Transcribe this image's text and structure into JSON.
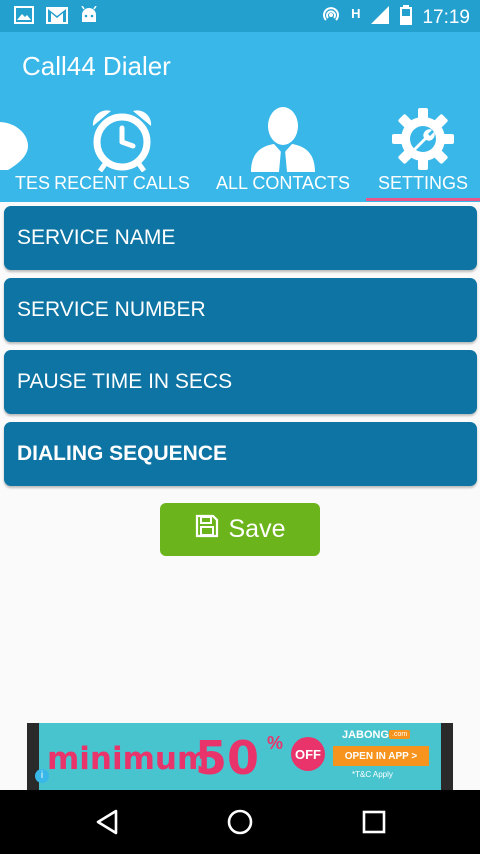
{
  "status_bar": {
    "time": "17:19",
    "network_label": "H",
    "icons": [
      "image-icon",
      "gmail-icon",
      "android-icon",
      "hotspot-icon",
      "signal-icon",
      "battery-icon"
    ]
  },
  "app": {
    "title": "Call44 Dialer",
    "colors": {
      "primary": "#39b7e8",
      "status": "#24a0cf",
      "card": "#0e74a3",
      "save": "#6cb41b",
      "indicator": "#e8578a"
    }
  },
  "tabs": [
    {
      "label": "TES",
      "icon": "favorite-icon"
    },
    {
      "label": "RECENT CALLS",
      "icon": "alarm-clock-icon"
    },
    {
      "label": "ALL CONTACTS",
      "icon": "person-icon"
    },
    {
      "label": "SETTINGS",
      "icon": "settings-wrench-icon",
      "selected": true
    }
  ],
  "settings": [
    {
      "label": "SERVICE NAME",
      "bold": false
    },
    {
      "label": "SERVICE NUMBER",
      "bold": false
    },
    {
      "label": "PAUSE TIME IN SECS",
      "bold": false
    },
    {
      "label": "DIALING SEQUENCE",
      "bold": true
    }
  ],
  "save_button": {
    "label": "Save",
    "icon": "floppy-disk-icon"
  },
  "ad": {
    "headline": "minimum",
    "percent_value": "50",
    "percent_sign": "%",
    "off_label": "OFF",
    "brand": "JABONG",
    "brand_suffix": ".com",
    "cta": "OPEN IN APP >",
    "terms": "*T&C Apply"
  },
  "nav_bar": {
    "buttons": [
      "back-icon",
      "home-icon",
      "recents-icon"
    ]
  }
}
